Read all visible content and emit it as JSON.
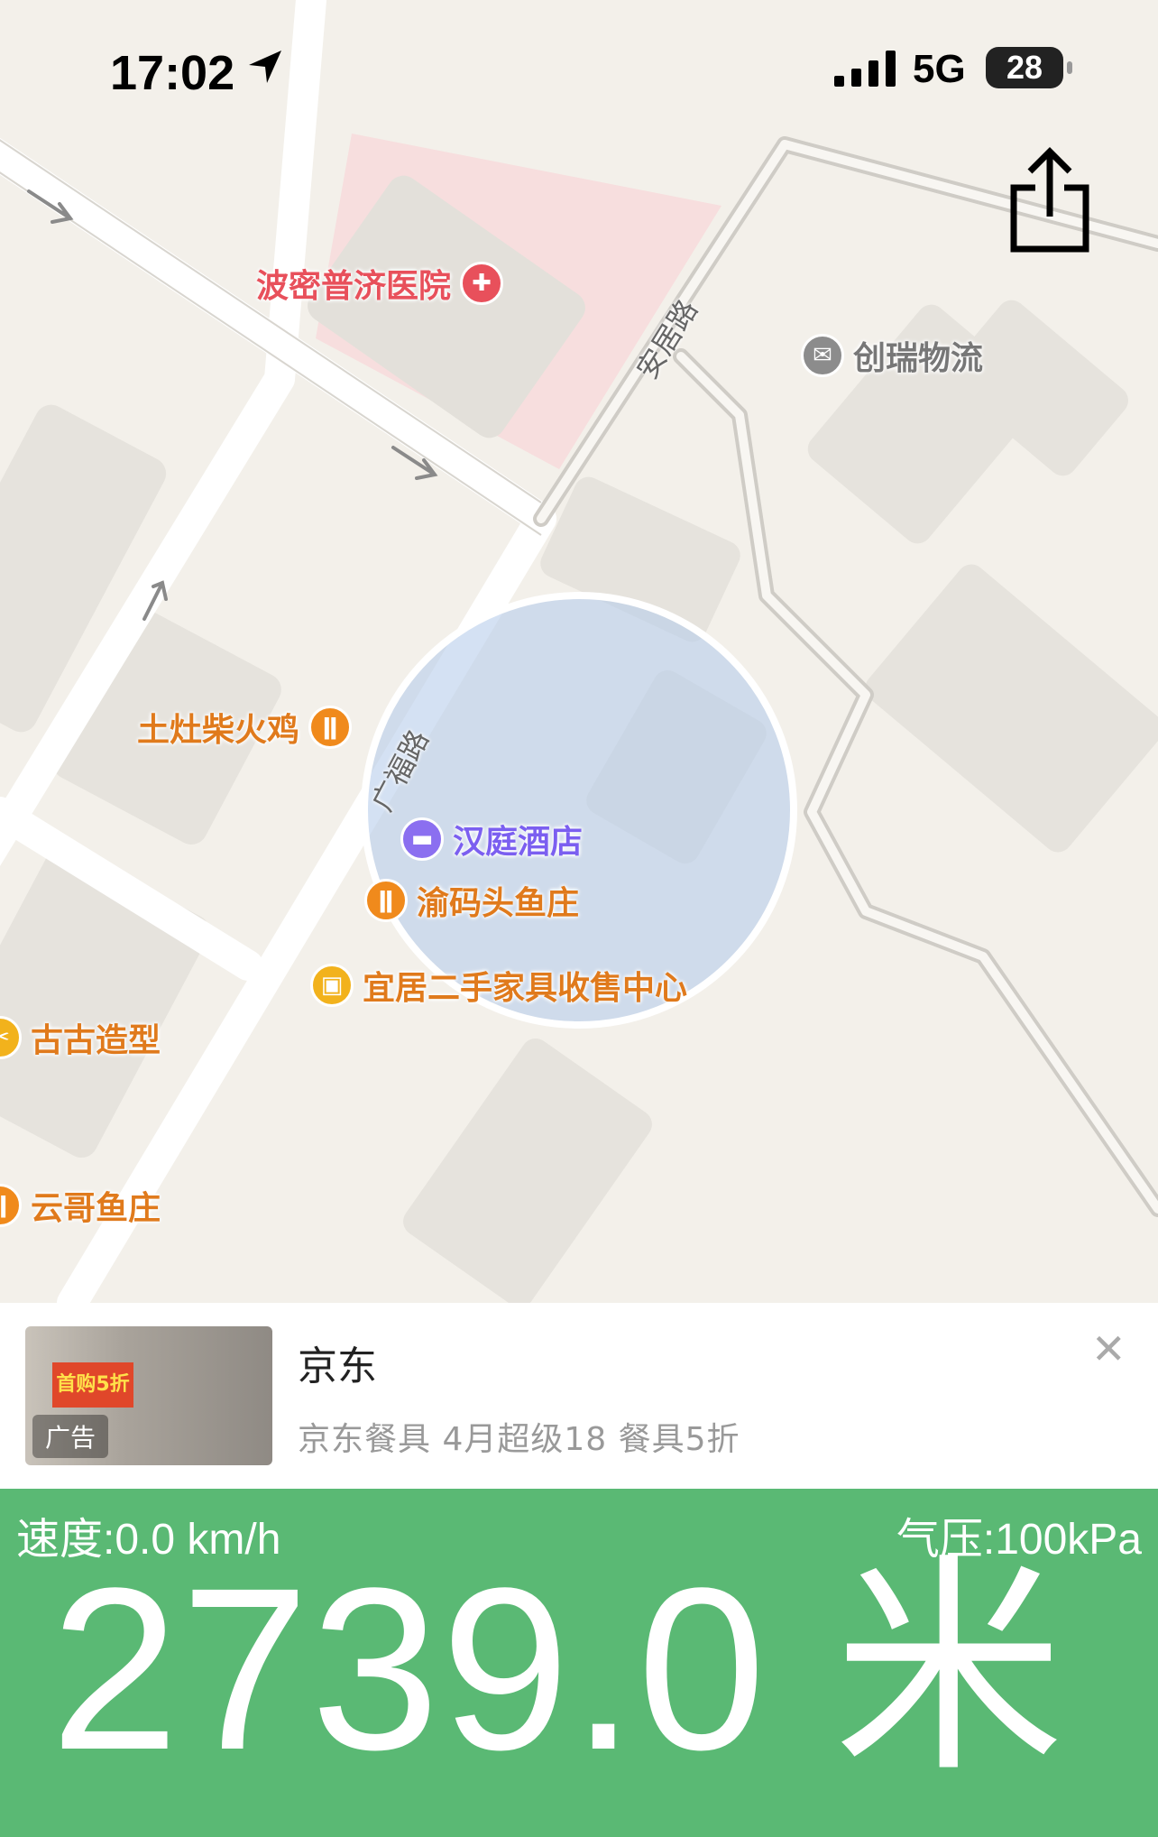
{
  "status_bar": {
    "time": "17:02",
    "network": "5G",
    "battery": "28"
  },
  "map": {
    "pois": [
      {
        "name": "波密普济医院",
        "icon": "hospital-icon",
        "color": "#e8505b"
      },
      {
        "name": "创瑞物流",
        "icon": "mail-icon",
        "color": "#8c8c8c"
      },
      {
        "name": "土灶柴火鸡",
        "icon": "restaurant-icon",
        "color": "#f08a1c"
      },
      {
        "name": "汉庭酒店",
        "icon": "hotel-icon",
        "color": "#8b6ff0"
      },
      {
        "name": "渝码头鱼庄",
        "icon": "restaurant-icon",
        "color": "#f08a1c"
      },
      {
        "name": "宜居二手家具收售中心",
        "icon": "shopping-icon",
        "color": "#f2b21c"
      },
      {
        "name": "古古造型",
        "icon": "scissors-icon",
        "color": "#f2b21c"
      },
      {
        "name": "云哥鱼庄",
        "icon": "restaurant-icon",
        "color": "#f08a1c"
      }
    ],
    "roads": {
      "anju": "安居路",
      "guangfu": "广福路"
    }
  },
  "ad": {
    "title": "京东",
    "description": "京东餐具 4月超级18 餐具5折",
    "badge": "广告",
    "promo": "首购5折"
  },
  "panel": {
    "speed": "速度:0.0 km/h",
    "pressure": "气压:100kPa",
    "altitude": "2739.0 米"
  }
}
